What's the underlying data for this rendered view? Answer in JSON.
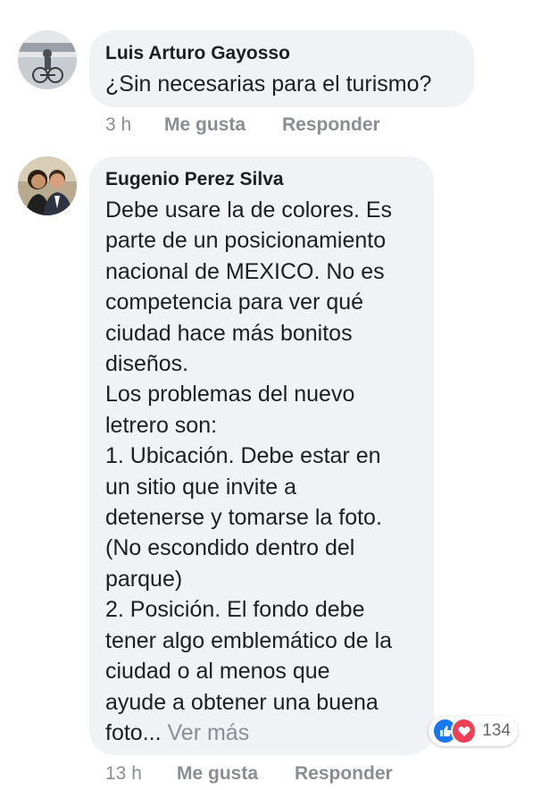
{
  "comments": [
    {
      "author": "Luis Arturo Gayosso",
      "lines": [
        "¿Sin necesarias para el turismo?"
      ],
      "time": "3 h",
      "like_label": "Me gusta",
      "reply_label": "Responder"
    },
    {
      "author": "Eugenio Perez Silva",
      "lines": [
        "Debe usare la de colores. Es",
        "parte de un posicionamiento",
        "nacional de MEXICO. No es",
        "competencia para ver qué",
        "ciudad hace más bonitos",
        "diseños.",
        "Los problemas del nuevo",
        "letrero son:",
        "1. Ubicación. Debe estar en",
        "un sitio que invite a",
        "detenerse y tomarse la foto.",
        "(No escondido dentro del",
        "parque)",
        "2. Posición. El fondo debe",
        "tener algo emblemático de la",
        "ciudad o al menos que",
        "ayude a obtener una buena"
      ],
      "last_line": "foto...",
      "see_more": "Ver más",
      "reaction_count": "134",
      "time": "13 h",
      "like_label": "Me gusta",
      "reply_label": "Responder"
    }
  ],
  "icons": {
    "like": "like-reaction-icon",
    "love": "love-reaction-icon"
  },
  "colors": {
    "bubble": "#f0f2f5",
    "meta_text": "#8a8d91",
    "like_blue": "#1877f2",
    "love_red": "#f33e58"
  }
}
